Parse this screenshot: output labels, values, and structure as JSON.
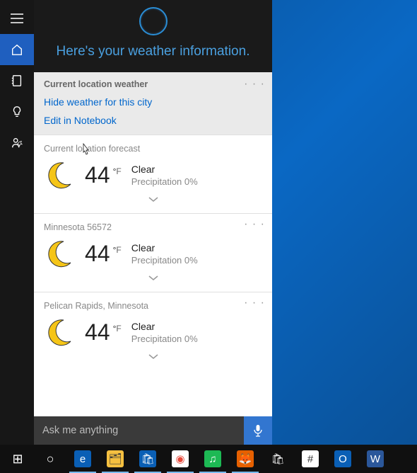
{
  "header": {
    "text": "Here's your weather information."
  },
  "section": {
    "title": "Current location weather",
    "hide_link": "Hide weather for this city",
    "edit_link": "Edit in Notebook",
    "more": "· · ·"
  },
  "cards": [
    {
      "title": "Current location forecast",
      "temp": "44",
      "unit_deg": "°",
      "unit_f": "F",
      "condition": "Clear",
      "precip": "Precipitation 0%",
      "show_more": false
    },
    {
      "title": "Minnesota 56572",
      "temp": "44",
      "unit_deg": "°",
      "unit_f": "F",
      "condition": "Clear",
      "precip": "Precipitation 0%",
      "show_more": true
    },
    {
      "title": "Pelican Rapids, Minnesota",
      "temp": "44",
      "unit_deg": "°",
      "unit_f": "F",
      "condition": "Clear",
      "precip": "Precipitation 0%",
      "show_more": true
    }
  ],
  "search": {
    "placeholder": "Ask me anything"
  },
  "taskbar": {
    "items": [
      {
        "name": "start",
        "glyph": "⊞",
        "bg": "",
        "fg": "#fff"
      },
      {
        "name": "cortana",
        "glyph": "○",
        "bg": "",
        "fg": "#fff"
      },
      {
        "name": "edge",
        "glyph": "e",
        "bg": "#0a5fb5",
        "fg": "#fff"
      },
      {
        "name": "file-explorer",
        "glyph": "🗂",
        "bg": "#f5c040",
        "fg": "#333"
      },
      {
        "name": "store",
        "glyph": "🛍",
        "bg": "#0a5fb5",
        "fg": "#fff"
      },
      {
        "name": "chrome",
        "glyph": "◉",
        "bg": "#fff",
        "fg": "#e84a3c"
      },
      {
        "name": "spotify",
        "glyph": "♫",
        "bg": "#1db954",
        "fg": "#fff"
      },
      {
        "name": "firefox",
        "glyph": "🦊",
        "bg": "#e66000",
        "fg": "#fff"
      },
      {
        "name": "shopping-bag",
        "glyph": "🛍",
        "bg": "",
        "fg": "#fff"
      },
      {
        "name": "slack",
        "glyph": "#",
        "bg": "#fff",
        "fg": "#333"
      },
      {
        "name": "outlook",
        "glyph": "O",
        "bg": "#0a5fb5",
        "fg": "#fff"
      },
      {
        "name": "word",
        "glyph": "W",
        "bg": "#2b579a",
        "fg": "#fff"
      }
    ]
  }
}
